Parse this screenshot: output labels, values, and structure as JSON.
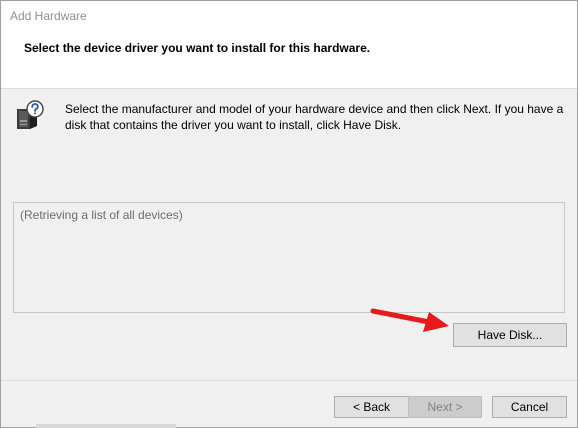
{
  "window": {
    "title": "Add Hardware"
  },
  "header": {
    "heading": "Select the device driver you want to install for this hardware."
  },
  "instructions": {
    "icon": "hardware-question-icon",
    "text": "Select the manufacturer and model of your hardware device and then click Next. If you have a disk that contains the driver you want to install, click Have Disk."
  },
  "device_list": {
    "status": "(Retrieving a list of all devices)"
  },
  "buttons": {
    "have_disk": "Have Disk...",
    "back": "< Back",
    "next": "Next >",
    "cancel": "Cancel"
  },
  "annotation": {
    "arrow_color": "#e8191b",
    "icon": "red-arrow-icon"
  }
}
